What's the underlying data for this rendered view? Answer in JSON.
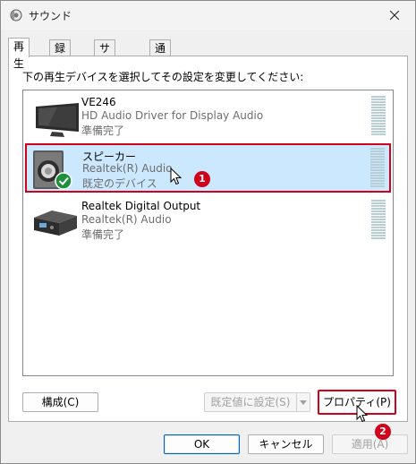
{
  "window": {
    "title": "サウンド"
  },
  "tabs": [
    {
      "label": "再生",
      "active": true
    },
    {
      "label": "録音",
      "active": false
    },
    {
      "label": "サウンド",
      "active": false
    },
    {
      "label": "通信",
      "active": false
    }
  ],
  "playback": {
    "instruction": "下の再生デバイスを選択してその設定を変更してください:",
    "devices": [
      {
        "name": "VE246",
        "line1": "HD Audio Driver for Display Audio",
        "line2": "準備完了",
        "icon": "monitor-icon",
        "selected": false
      },
      {
        "name": "スピーカー",
        "line1": "Realtek(R) Audio",
        "line2": "既定のデバイス",
        "icon": "speaker-icon",
        "selected": true,
        "default": true
      },
      {
        "name": "Realtek Digital Output",
        "line1": "Realtek(R) Audio",
        "line2": "準備完了",
        "icon": "digital-output-icon",
        "selected": false
      }
    ]
  },
  "buttons": {
    "configure": "構成(C)",
    "set_default": "既定値に設定(S)",
    "properties": "プロパティ(P)",
    "ok": "OK",
    "cancel": "キャンセル",
    "apply": "適用(A)"
  },
  "annotations": {
    "step1": "1",
    "step2": "2"
  },
  "colors": {
    "highlight": "#d0021b",
    "selection": "#cce8ff",
    "accent": "#005fb8",
    "check": "#1e8f3a"
  }
}
